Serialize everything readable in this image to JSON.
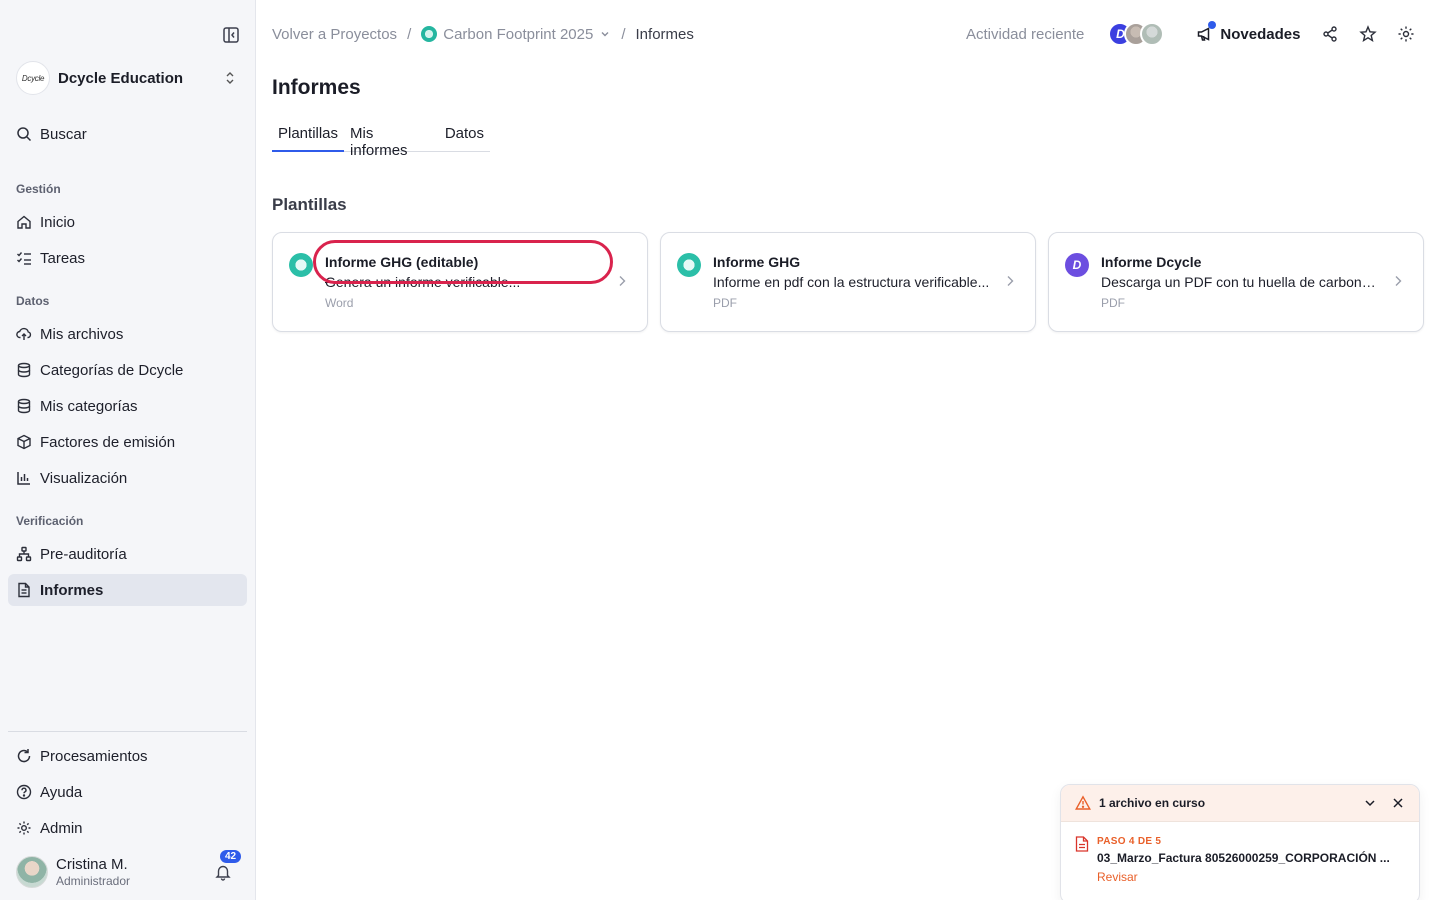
{
  "sidebar": {
    "org_logo_text": "Dcycle",
    "org_name": "Dcycle Education",
    "search_label": "Buscar",
    "sections": {
      "gestion": "Gestión",
      "datos": "Datos",
      "verificacion": "Verificación"
    },
    "items": {
      "inicio": "Inicio",
      "tareas": "Tareas",
      "mis_archivos": "Mis archivos",
      "categorias_dcycle": "Categorías de Dcycle",
      "mis_categorias": "Mis categorías",
      "factores": "Factores de emisión",
      "visualizacion": "Visualización",
      "preauditoria": "Pre-auditoría",
      "informes": "Informes",
      "procesamientos": "Procesamientos",
      "ayuda": "Ayuda",
      "admin": "Admin"
    },
    "user": {
      "name": "Cristina M.",
      "role": "Administrador",
      "notifications": "42"
    }
  },
  "topbar": {
    "back": "Volver a Proyectos",
    "project": "Carbon Footprint 2025",
    "current": "Informes",
    "recent": "Actividad reciente",
    "news": "Novedades",
    "avatar_letter": "D"
  },
  "main": {
    "title": "Informes",
    "tabs": [
      "Plantillas",
      "Mis informes",
      "Datos"
    ],
    "section_title": "Plantillas",
    "cards": [
      {
        "title": "Informe GHG (editable)",
        "desc": "Genera un informe verificable...",
        "type": "Word"
      },
      {
        "title": "Informe GHG",
        "desc": "Informe en pdf con la estructura verificable...",
        "type": "PDF"
      },
      {
        "title": "Informe Dcycle",
        "desc": "Descarga un PDF con tu huella de carbono...",
        "type": "PDF",
        "icon_letter": "D"
      }
    ]
  },
  "toast": {
    "title": "1 archivo en curso",
    "step": "PASO 4 DE 5",
    "filename": "03_Marzo_Factura 80526000259_CORPORACIÓN ...",
    "action": "Revisar"
  },
  "colors": {
    "accent": "#2f5bea",
    "highlight": "#d9234d",
    "warning": "#e9602a"
  }
}
